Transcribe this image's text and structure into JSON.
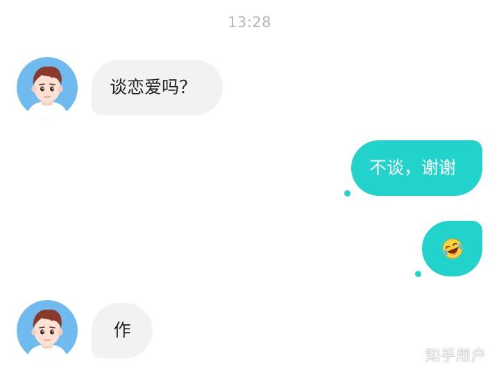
{
  "chat": {
    "timestamp": "13:28",
    "messages": [
      {
        "side": "incoming",
        "text": "谈恋爱吗？",
        "avatar_icon": "boy-avatar-icon"
      },
      {
        "side": "outgoing",
        "text": "不谈，谢谢"
      },
      {
        "side": "outgoing",
        "emoji_icon": "laughing-crying-emoji-icon"
      },
      {
        "side": "incoming",
        "text": "作",
        "avatar_icon": "boy-avatar-icon"
      }
    ]
  },
  "watermark": {
    "text": "知乎用户"
  },
  "colors": {
    "outgoing_bubble": "#22d3cc",
    "incoming_bubble": "#f2f2f2",
    "avatar_background": "#6fbbef",
    "timestamp_text": "#b4b4b4"
  }
}
